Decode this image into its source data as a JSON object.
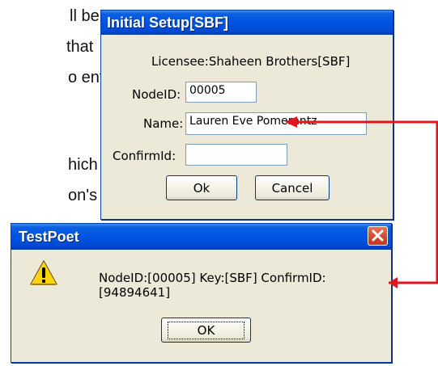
{
  "background_text": [
    "ll be",
    "that",
    "o enter",
    "hich",
    "on's"
  ],
  "setup_dialog": {
    "title": "Initial Setup[SBF]",
    "licensee": "Licensee:Shaheen Brothers[SBF]",
    "nodeid_label": "NodeID:",
    "nodeid_value": "00005",
    "name_label": "Name:",
    "name_value": "Lauren Eve Pomerantz",
    "confirmid_label": "ConfirmId:",
    "confirmid_value": "",
    "ok_label": "Ok",
    "cancel_label": "Cancel"
  },
  "message_dialog": {
    "title": "TestPoet",
    "message": "NodeID:[00005] Key:[SBF] ConfirmID:[94894641]",
    "ok_label": "OK",
    "icon": "warning-icon"
  },
  "colors": {
    "titlebar": "#0054e3",
    "dialog_bg": "#ece9d8",
    "arrow": "#e0161b"
  }
}
